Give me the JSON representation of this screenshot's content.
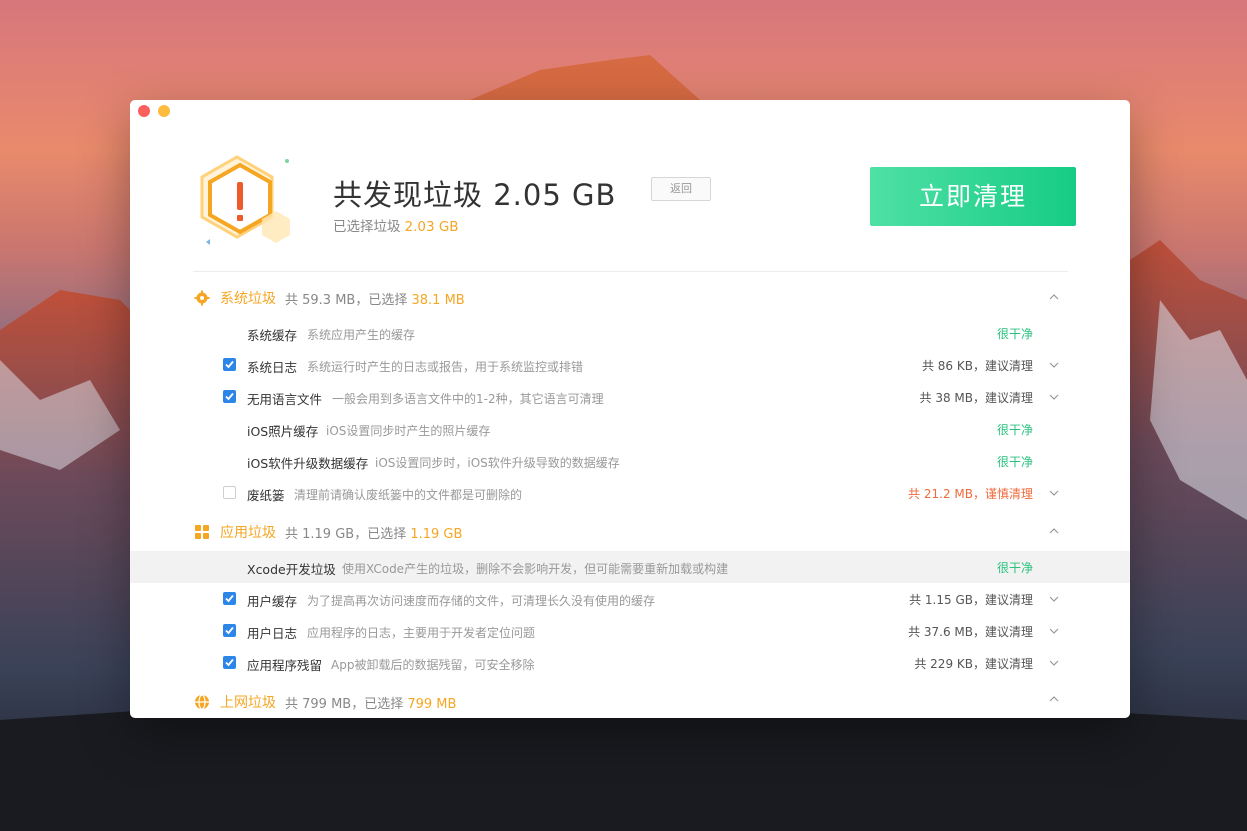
{
  "colors": {
    "accent": "#f5a623",
    "primary_button": "#16cc84",
    "ok": "#28c27e",
    "warn": "#f06a3b",
    "checkbox": "#2b86e8"
  },
  "header": {
    "title": "共发现垃圾 2.05 GB",
    "selected_label": "已选择垃圾",
    "selected_amount": "2.03 GB",
    "back_label": "返回",
    "clean_label": "立即清理",
    "logo_icon": "warning-hexagon-icon"
  },
  "sections": [
    {
      "icon": "gear-icon",
      "title": "系统垃圾",
      "info_prefix": "共 59.3 MB，已选择",
      "selected": "38.1 MB",
      "items": [
        {
          "name": "系统缓存",
          "desc": "系统应用产生的缓存",
          "status": "很干净",
          "checkbox": "none"
        },
        {
          "name": "系统日志",
          "desc": "系统运行时产生的日志或报告，用于系统监控或排错",
          "status": "共 86 KB，建议清理",
          "checkbox": "checked"
        },
        {
          "name": "无用语言文件",
          "desc": "一般会用到多语言文件中的1-2种，其它语言可清理",
          "status": "共 38 MB，建议清理",
          "checkbox": "checked"
        },
        {
          "name": "iOS照片缓存",
          "desc": "iOS设置同步时产生的照片缓存",
          "status": "很干净",
          "checkbox": "none"
        },
        {
          "name": "iOS软件升级数据缓存",
          "desc": "iOS设置同步时，iOS软件升级导致的数据缓存",
          "status": "很干净",
          "checkbox": "none"
        },
        {
          "name": "废纸篓",
          "desc": "清理前请确认废纸篓中的文件都是可删除的",
          "status_size": "共 21.2 MB，",
          "status_advice": "谨慎清理",
          "checkbox": "unchecked"
        }
      ]
    },
    {
      "icon": "grid-apps-icon",
      "title": "应用垃圾",
      "info_prefix": "共 1.19 GB，已选择",
      "selected": "1.19 GB",
      "items": [
        {
          "name": "Xcode开发垃圾",
          "desc": "使用XCode产生的垃圾，删除不会影响开发，但可能需要重新加载或构建",
          "status": "很干净",
          "checkbox": "none"
        },
        {
          "name": "用户缓存",
          "desc": "为了提高再次访问速度而存储的文件，可清理长久没有使用的缓存",
          "status": "共 1.15 GB，建议清理",
          "checkbox": "checked"
        },
        {
          "name": "用户日志",
          "desc": "应用程序的日志，主要用于开发者定位问题",
          "status": "共 37.6 MB，建议清理",
          "checkbox": "checked"
        },
        {
          "name": "应用程序残留",
          "desc": "App被卸载后的数据残留，可安全移除",
          "status": "共 229 KB，建议清理",
          "checkbox": "checked"
        }
      ]
    },
    {
      "icon": "globe-icon",
      "title": "上网垃圾",
      "info_prefix": "共 799 MB，已选择",
      "selected": "799 MB",
      "items": []
    }
  ]
}
